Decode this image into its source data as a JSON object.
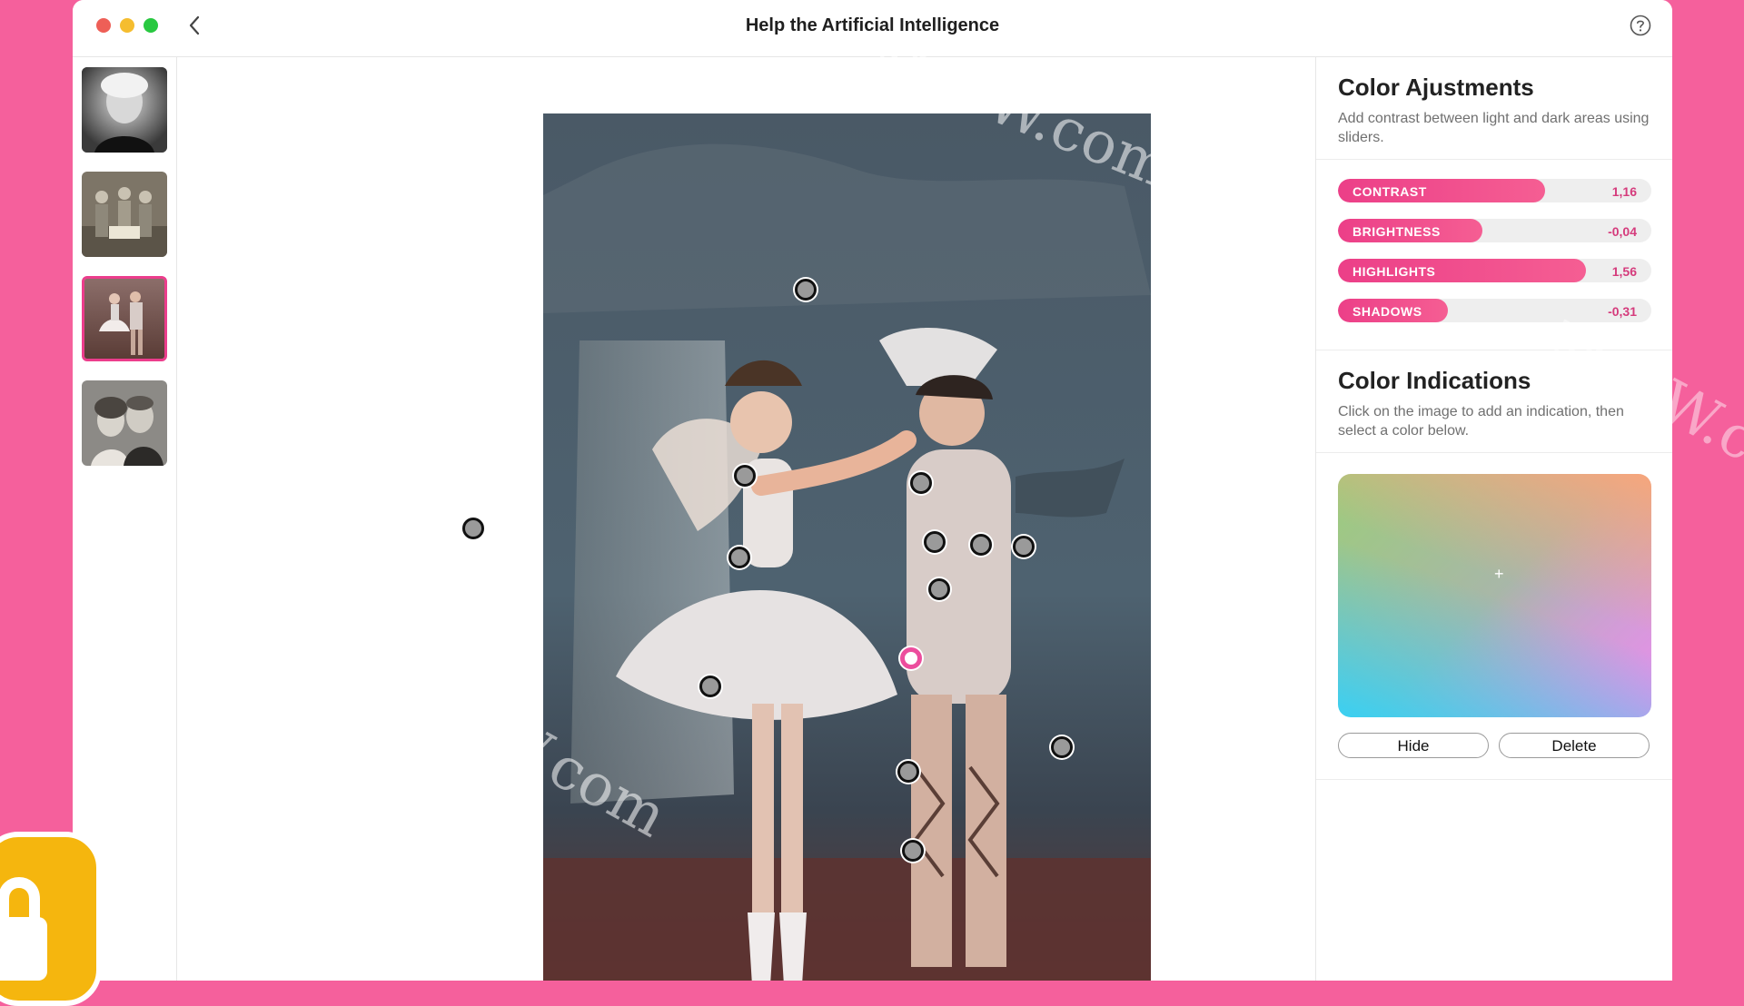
{
  "window": {
    "title": "Help the Artificial Intelligence"
  },
  "thumbnails": [
    {
      "name": "portrait-woman-bw",
      "selected": false
    },
    {
      "name": "group-photo-sepia",
      "selected": false
    },
    {
      "name": "two-dancers-photo",
      "selected": true
    },
    {
      "name": "couple-portrait",
      "selected": false
    }
  ],
  "adjustments": {
    "title": "Color Ajustments",
    "description": "Add contrast between light and dark areas using sliders.",
    "sliders": [
      {
        "label": "CONTRAST",
        "value": "1,16",
        "fill_fraction": 0.66
      },
      {
        "label": "BRIGHTNESS",
        "value": "-0,04",
        "fill_fraction": 0.46
      },
      {
        "label": "HIGHLIGHTS",
        "value": "1,56",
        "fill_fraction": 0.79
      },
      {
        "label": "SHADOWS",
        "value": "-0,31",
        "fill_fraction": 0.35
      }
    ]
  },
  "indications": {
    "title": "Color Indications",
    "description": "Click on the image to add an indication, then select a color below.",
    "hide_label": "Hide",
    "delete_label": "Delete"
  },
  "watermark": "MacW.com",
  "colors": {
    "accent": "#ec3d8c",
    "background": "#f5609c",
    "lock": "#f5b60e"
  }
}
